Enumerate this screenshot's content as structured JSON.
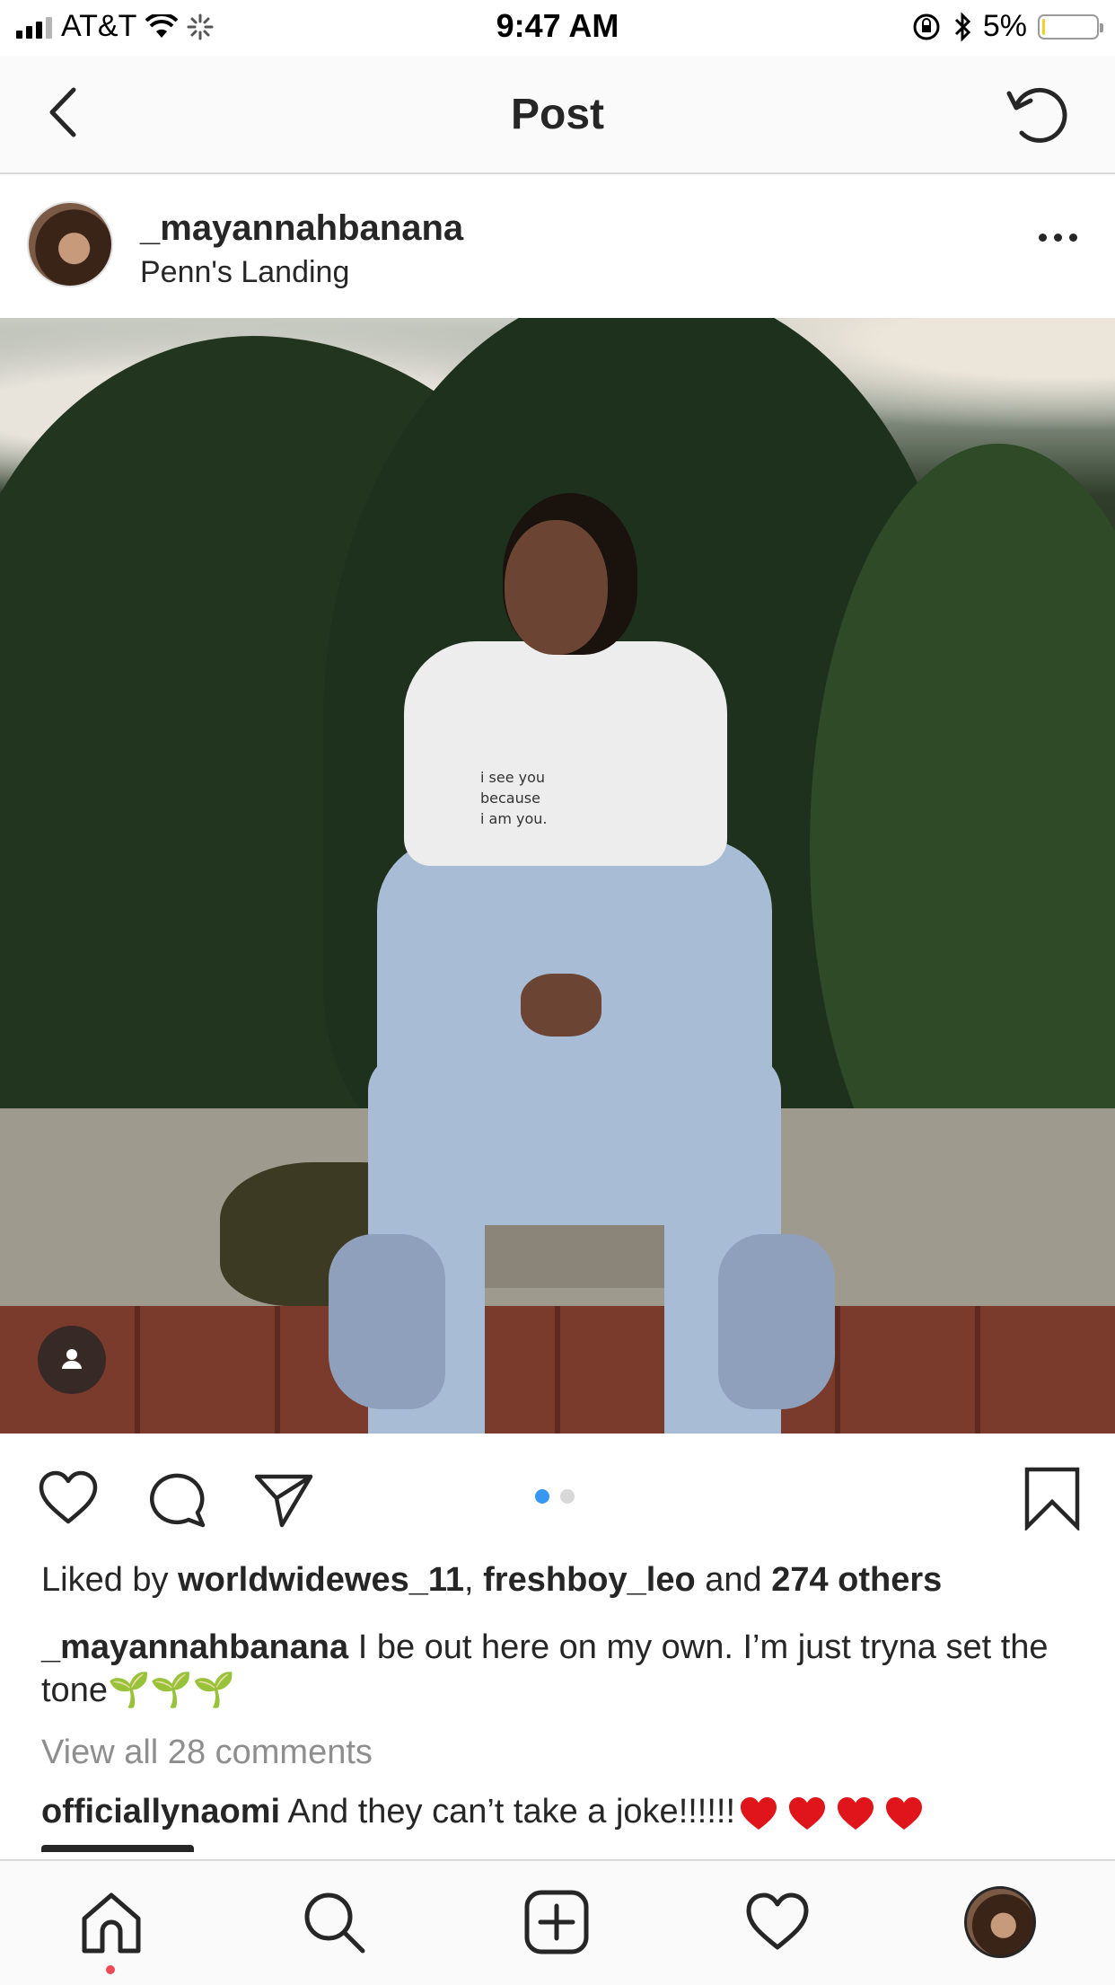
{
  "status_bar": {
    "carrier": "AT&T",
    "time": "9:47 AM",
    "battery_percent": "5%",
    "battery_level": 0.05,
    "icons": [
      "signal-icon",
      "wifi-icon",
      "loading-icon",
      "rotation-lock-icon",
      "bluetooth-icon",
      "battery-icon"
    ]
  },
  "header": {
    "title": "Post",
    "back_icon": "chevron-left-icon",
    "refresh_icon": "refresh-icon"
  },
  "post": {
    "username": "_mayannahbanana",
    "location": "Penn's Landing",
    "more_icon": "more-dots-icon",
    "shirt_text": [
      "i see you",
      "because",
      "i am you."
    ],
    "carousel": {
      "count": 2,
      "active": 1,
      "active_color": "#3897f0",
      "inactive_color": "#d8d8d8"
    },
    "likes": {
      "prefix": "Liked by",
      "user1": "worldwidewes_11",
      "separator": ",",
      "user2": "freshboy_leo",
      "conj": "and",
      "others": "274 others"
    },
    "caption": {
      "username": "_mayannahbanana",
      "text": "I be out here on my own. I’m just tryna set the tone",
      "emoji": "🌱🌱🌱"
    },
    "view_all_comments": "View all 28 comments",
    "comments": [
      {
        "username": "officiallynaomi",
        "text": "And they can’t take a joke!!!!!!"
      }
    ]
  },
  "tab_bar": {
    "tabs": [
      "home-icon",
      "search-icon",
      "new-post-icon",
      "activity-heart-icon",
      "profile-avatar"
    ],
    "accent_color": "#ed4956"
  }
}
